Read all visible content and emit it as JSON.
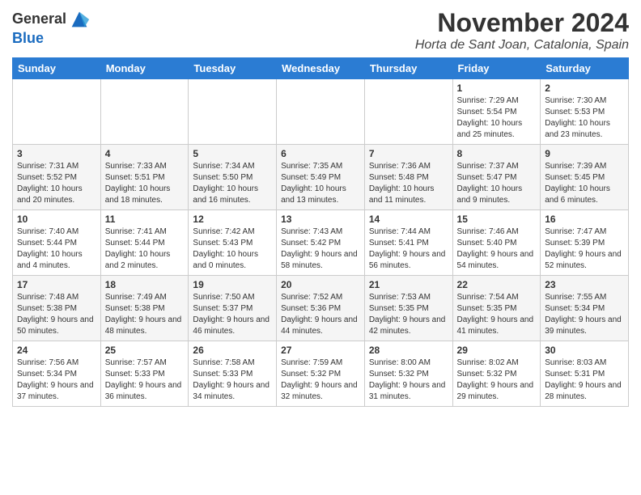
{
  "header": {
    "logo_general": "General",
    "logo_blue": "Blue",
    "month_title": "November 2024",
    "location": "Horta de Sant Joan, Catalonia, Spain"
  },
  "weekdays": [
    "Sunday",
    "Monday",
    "Tuesday",
    "Wednesday",
    "Thursday",
    "Friday",
    "Saturday"
  ],
  "weeks": [
    [
      {
        "day": "",
        "info": ""
      },
      {
        "day": "",
        "info": ""
      },
      {
        "day": "",
        "info": ""
      },
      {
        "day": "",
        "info": ""
      },
      {
        "day": "",
        "info": ""
      },
      {
        "day": "1",
        "info": "Sunrise: 7:29 AM\nSunset: 5:54 PM\nDaylight: 10 hours and 25 minutes."
      },
      {
        "day": "2",
        "info": "Sunrise: 7:30 AM\nSunset: 5:53 PM\nDaylight: 10 hours and 23 minutes."
      }
    ],
    [
      {
        "day": "3",
        "info": "Sunrise: 7:31 AM\nSunset: 5:52 PM\nDaylight: 10 hours and 20 minutes."
      },
      {
        "day": "4",
        "info": "Sunrise: 7:33 AM\nSunset: 5:51 PM\nDaylight: 10 hours and 18 minutes."
      },
      {
        "day": "5",
        "info": "Sunrise: 7:34 AM\nSunset: 5:50 PM\nDaylight: 10 hours and 16 minutes."
      },
      {
        "day": "6",
        "info": "Sunrise: 7:35 AM\nSunset: 5:49 PM\nDaylight: 10 hours and 13 minutes."
      },
      {
        "day": "7",
        "info": "Sunrise: 7:36 AM\nSunset: 5:48 PM\nDaylight: 10 hours and 11 minutes."
      },
      {
        "day": "8",
        "info": "Sunrise: 7:37 AM\nSunset: 5:47 PM\nDaylight: 10 hours and 9 minutes."
      },
      {
        "day": "9",
        "info": "Sunrise: 7:39 AM\nSunset: 5:45 PM\nDaylight: 10 hours and 6 minutes."
      }
    ],
    [
      {
        "day": "10",
        "info": "Sunrise: 7:40 AM\nSunset: 5:44 PM\nDaylight: 10 hours and 4 minutes."
      },
      {
        "day": "11",
        "info": "Sunrise: 7:41 AM\nSunset: 5:44 PM\nDaylight: 10 hours and 2 minutes."
      },
      {
        "day": "12",
        "info": "Sunrise: 7:42 AM\nSunset: 5:43 PM\nDaylight: 10 hours and 0 minutes."
      },
      {
        "day": "13",
        "info": "Sunrise: 7:43 AM\nSunset: 5:42 PM\nDaylight: 9 hours and 58 minutes."
      },
      {
        "day": "14",
        "info": "Sunrise: 7:44 AM\nSunset: 5:41 PM\nDaylight: 9 hours and 56 minutes."
      },
      {
        "day": "15",
        "info": "Sunrise: 7:46 AM\nSunset: 5:40 PM\nDaylight: 9 hours and 54 minutes."
      },
      {
        "day": "16",
        "info": "Sunrise: 7:47 AM\nSunset: 5:39 PM\nDaylight: 9 hours and 52 minutes."
      }
    ],
    [
      {
        "day": "17",
        "info": "Sunrise: 7:48 AM\nSunset: 5:38 PM\nDaylight: 9 hours and 50 minutes."
      },
      {
        "day": "18",
        "info": "Sunrise: 7:49 AM\nSunset: 5:38 PM\nDaylight: 9 hours and 48 minutes."
      },
      {
        "day": "19",
        "info": "Sunrise: 7:50 AM\nSunset: 5:37 PM\nDaylight: 9 hours and 46 minutes."
      },
      {
        "day": "20",
        "info": "Sunrise: 7:52 AM\nSunset: 5:36 PM\nDaylight: 9 hours and 44 minutes."
      },
      {
        "day": "21",
        "info": "Sunrise: 7:53 AM\nSunset: 5:35 PM\nDaylight: 9 hours and 42 minutes."
      },
      {
        "day": "22",
        "info": "Sunrise: 7:54 AM\nSunset: 5:35 PM\nDaylight: 9 hours and 41 minutes."
      },
      {
        "day": "23",
        "info": "Sunrise: 7:55 AM\nSunset: 5:34 PM\nDaylight: 9 hours and 39 minutes."
      }
    ],
    [
      {
        "day": "24",
        "info": "Sunrise: 7:56 AM\nSunset: 5:34 PM\nDaylight: 9 hours and 37 minutes."
      },
      {
        "day": "25",
        "info": "Sunrise: 7:57 AM\nSunset: 5:33 PM\nDaylight: 9 hours and 36 minutes."
      },
      {
        "day": "26",
        "info": "Sunrise: 7:58 AM\nSunset: 5:33 PM\nDaylight: 9 hours and 34 minutes."
      },
      {
        "day": "27",
        "info": "Sunrise: 7:59 AM\nSunset: 5:32 PM\nDaylight: 9 hours and 32 minutes."
      },
      {
        "day": "28",
        "info": "Sunrise: 8:00 AM\nSunset: 5:32 PM\nDaylight: 9 hours and 31 minutes."
      },
      {
        "day": "29",
        "info": "Sunrise: 8:02 AM\nSunset: 5:32 PM\nDaylight: 9 hours and 29 minutes."
      },
      {
        "day": "30",
        "info": "Sunrise: 8:03 AM\nSunset: 5:31 PM\nDaylight: 9 hours and 28 minutes."
      }
    ]
  ]
}
